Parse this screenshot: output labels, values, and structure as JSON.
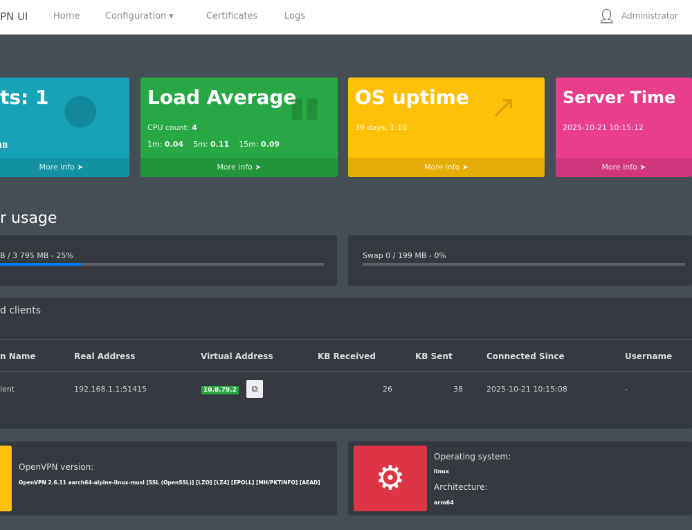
{
  "nav": {
    "brand": "PN UI",
    "items": [
      "Home",
      "Configuration ▾",
      "Certificates",
      "Logs"
    ],
    "user": "Administrator"
  },
  "boxes": [
    {
      "title": "ts: 1",
      "line1": "MB",
      "more": "More info",
      "color": "#17a2b8",
      "icon": "users-icon"
    },
    {
      "title": "Load Average",
      "cpu_label": "CPU count:",
      "cpu": "4",
      "l1_label": "1m:",
      "l1": "0.04",
      "l5_label": "5m:",
      "l5": "0.11",
      "l15_label": "15m:",
      "l15": "0.09",
      "more": "More info",
      "color": "#28a745",
      "icon": "bar-chart-icon"
    },
    {
      "title": "OS uptime",
      "line1": "39 days, 1:10",
      "more": "More info",
      "color": "#ffc107",
      "icon": "trend-up-icon"
    },
    {
      "title": "Server Time",
      "line1": "2025-10-21 10:15:12",
      "more": "More info",
      "color": "#e83e8c",
      "icon": "clock-icon"
    }
  ],
  "memory": {
    "heading": "r usage",
    "mem_text": "B / 3 795 MB - 25%",
    "mem_percent": 25,
    "swap_text": "Swap 0 / 199 MB - 0%",
    "swap_percent": 0
  },
  "clients": {
    "heading": "d clients",
    "columns": [
      "n Name",
      "Real Address",
      "Virtual Address",
      "KB Received",
      "KB Sent",
      "Connected Since",
      "Username"
    ],
    "rows": [
      {
        "name": "ient",
        "real": "192.168.1.1:51415",
        "virtual": "10.8.79.2",
        "received": "26",
        "sent": "38",
        "since": "2025-10-21 10:15:08",
        "username": "-"
      }
    ]
  },
  "info": {
    "openvpn_label": "OpenVPN version:",
    "openvpn_value": "OpenVPN 2.6.11 aarch64-alpine-linux-musl [SSL (OpenSSL)] [LZO] [LZ4] [EPOLL] [MH/PKTINFO] [AEAD]",
    "os_label": "Operating system:",
    "os_value": "linux",
    "arch_label": "Architecture:",
    "arch_value": "arm64"
  }
}
